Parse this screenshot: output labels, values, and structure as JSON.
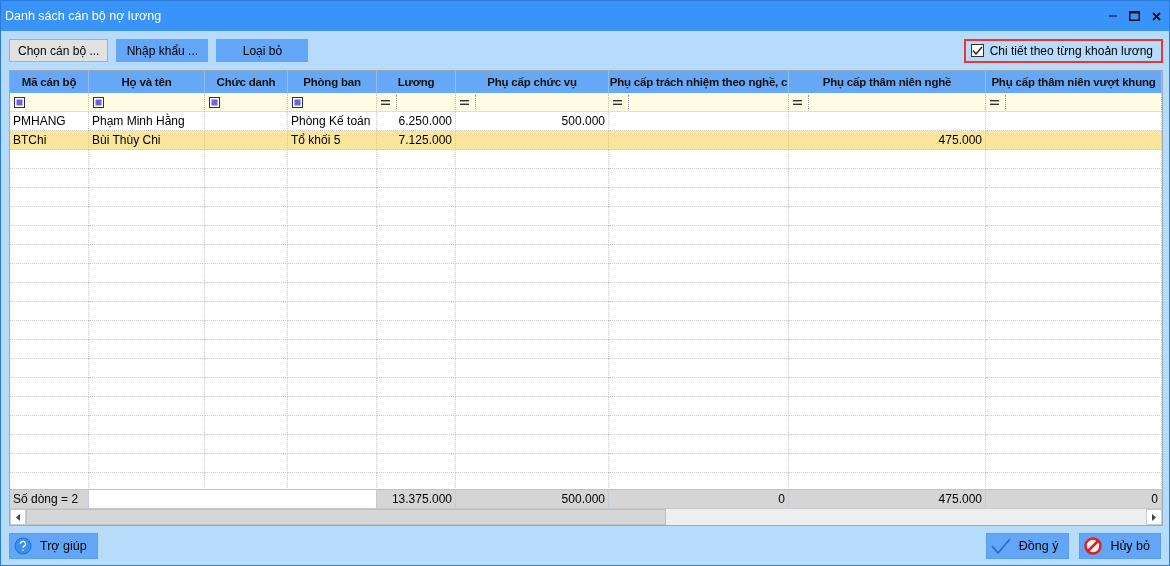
{
  "window": {
    "title": "Danh sách cán bộ nợ lương"
  },
  "toolbar": {
    "buttons": [
      {
        "label": "Chọn cán bộ ...",
        "kind": "default"
      },
      {
        "label": "Nhập khẩu ...",
        "kind": "accent"
      },
      {
        "label": "Loại bỏ",
        "kind": "accent"
      }
    ],
    "detail_checkbox": {
      "label": "Chi tiết theo từng khoản lương",
      "checked": true,
      "highlighted": true
    }
  },
  "table": {
    "columns": [
      {
        "label": "Mã cán bộ",
        "kind": "text"
      },
      {
        "label": "Họ và tên",
        "kind": "text"
      },
      {
        "label": "Chức danh",
        "kind": "text"
      },
      {
        "label": "Phòng ban",
        "kind": "text"
      },
      {
        "label": "Lương",
        "kind": "number"
      },
      {
        "label": "Phụ cấp chức vụ",
        "kind": "number"
      },
      {
        "label": "Phụ cấp trách nhiệm theo nghề, c",
        "kind": "number"
      },
      {
        "label": "Phụ cấp thâm niên nghề",
        "kind": "number"
      },
      {
        "label": "Phụ cấp thâm niên vượt khung",
        "kind": "number"
      }
    ],
    "rows": [
      {
        "selected": false,
        "cells": [
          "PMHANG",
          "Phạm Minh Hằng",
          "",
          "Phòng Kế toán",
          "6.250.000",
          "500.000",
          "",
          "",
          ""
        ]
      },
      {
        "selected": true,
        "cells": [
          "BTChi",
          "Bùi Thùy Chi",
          "",
          "Tổ khối 5",
          "7.125.000",
          "",
          "",
          "475.000",
          ""
        ]
      }
    ],
    "footer": {
      "label": "Số dòng = 2",
      "totals": [
        "13.375.000",
        "500.000",
        "0",
        "475.000",
        "0"
      ]
    }
  },
  "bottom_buttons": [
    {
      "label": "Trợ giúp",
      "kind": "help"
    },
    {
      "label": "Đồng ý",
      "kind": "ok"
    },
    {
      "label": "Hủy bỏ",
      "kind": "cancel"
    }
  ]
}
